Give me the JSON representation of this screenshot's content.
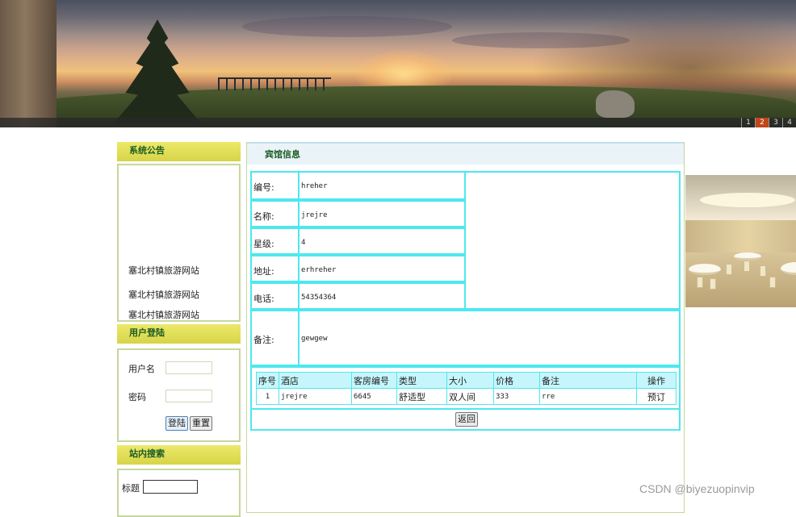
{
  "banner": {
    "pages": [
      "1",
      "2",
      "3",
      "4"
    ],
    "active_page": "2"
  },
  "sidebar": {
    "notice_title": "系统公告",
    "notice_items": [
      "塞北村镇旅游网站",
      "塞北村镇旅游网站",
      "塞北村镇旅游网站"
    ],
    "login_title": "用户登陆",
    "username_label": "用户名",
    "password_label": "密码",
    "login_button": "登陆",
    "reset_button": "重置",
    "search_title": "站内搜索",
    "search_label": "标题"
  },
  "panel": {
    "title": "宾馆信息",
    "fields": {
      "id_label": "编号:",
      "id_value": "hreher",
      "name_label": "名称:",
      "name_value": "jrejre",
      "star_label": "星级:",
      "star_value": "4",
      "address_label": "地址:",
      "address_value": "erhreher",
      "phone_label": "电话:",
      "phone_value": "54354364",
      "remark_label": "备注:",
      "remark_value": "gewgew"
    },
    "photo_icon": "hotel-banquet-hall-photo",
    "rooms": {
      "headers": [
        "序号",
        "酒店",
        "客房编号",
        "类型",
        "大小",
        "价格",
        "备注",
        "操作"
      ],
      "rows": [
        {
          "index": "1",
          "hotel": "jrejre",
          "room_no": "6645",
          "type": "舒适型",
          "size": "双人间",
          "price": "333",
          "remark": "rre",
          "action": "预订"
        }
      ]
    },
    "back_button": "返回"
  },
  "watermark": "CSDN @biyezuopinvip"
}
